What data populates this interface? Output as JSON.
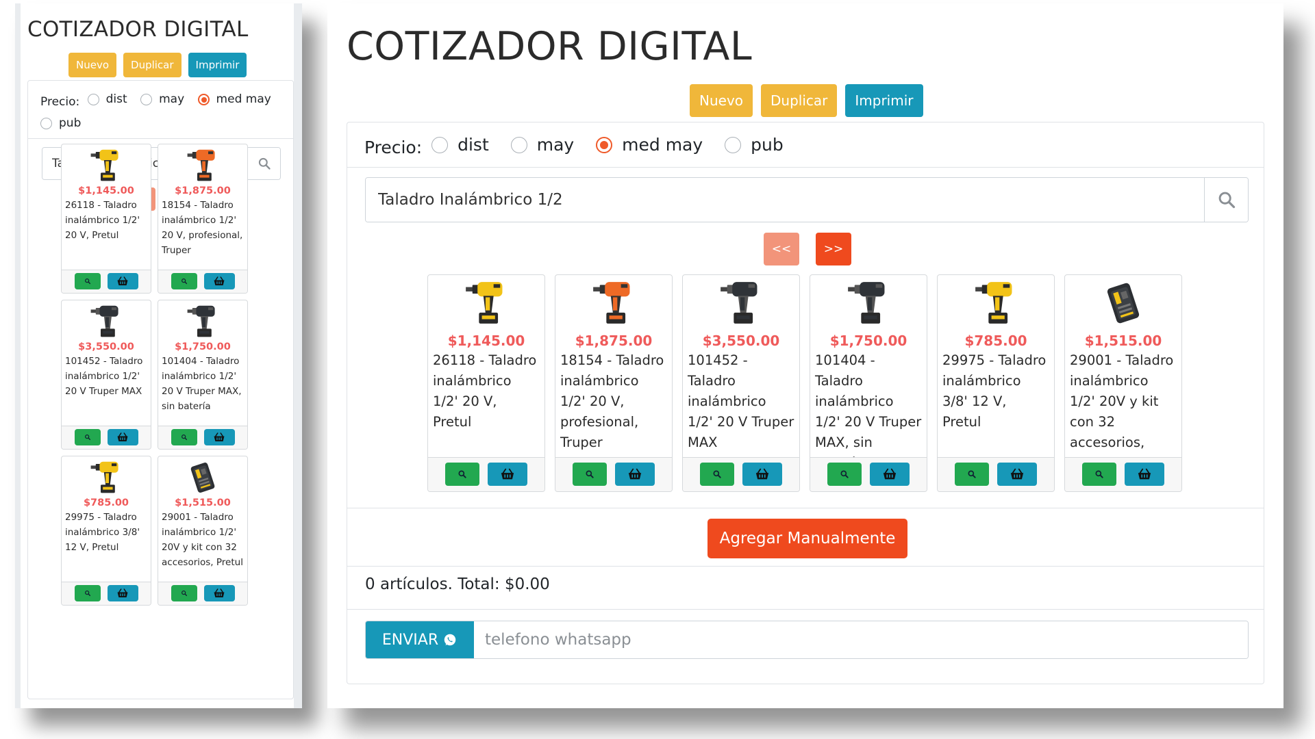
{
  "app": {
    "title": "COTIZADOR DIGITAL",
    "buttons": {
      "nuevo": "Nuevo",
      "duplicar": "Duplicar",
      "imprimir": "Imprimir"
    }
  },
  "price_filter": {
    "label": "Precio:",
    "options": [
      "dist",
      "may",
      "med may",
      "pub"
    ],
    "selected": "med may"
  },
  "search": {
    "value": "Taladro Inalámbrico 1/2"
  },
  "pager": {
    "prev": "<<",
    "next": ">>"
  },
  "products": [
    {
      "price": "$1,145.00",
      "desc": "26118 - Taladro inalámbrico 1/2' 20 V, Pretul",
      "icon": "drill-yellow-icon"
    },
    {
      "price": "$1,875.00",
      "desc": "18154 - Taladro inalámbrico 1/2' 20 V, profesional, Truper",
      "icon": "drill-orange-icon"
    },
    {
      "price": "$3,550.00",
      "desc": "101452 - Taladro inalámbrico 1/2' 20 V Truper MAX",
      "icon": "drill-black-icon"
    },
    {
      "price": "$1,750.00",
      "desc": "101404 - Taladro inalámbrico 1/2' 20 V Truper MAX, sin batería",
      "icon": "drill-black-icon"
    },
    {
      "price": "$785.00",
      "desc": "29975 - Taladro inalámbrico 3/8' 12 V, Pretul",
      "icon": "drill-yellow-icon"
    },
    {
      "price": "$1,515.00",
      "desc": "29001 - Taladro inalámbrico 1/2' 20V y kit con 32 accesorios, Pretul",
      "icon": "drill-kit-icon"
    }
  ],
  "manual_add": "Agregar Manualmente",
  "total": "0 artículos. Total: $0.00",
  "send": {
    "label": "ENVIAR",
    "placeholder": "telefono whatsapp"
  },
  "colors": {
    "warning": "#f0b73a",
    "info": "#1798b8",
    "accent": "#ef4a1e",
    "price": "#ef5a5a",
    "success": "#22a850"
  }
}
